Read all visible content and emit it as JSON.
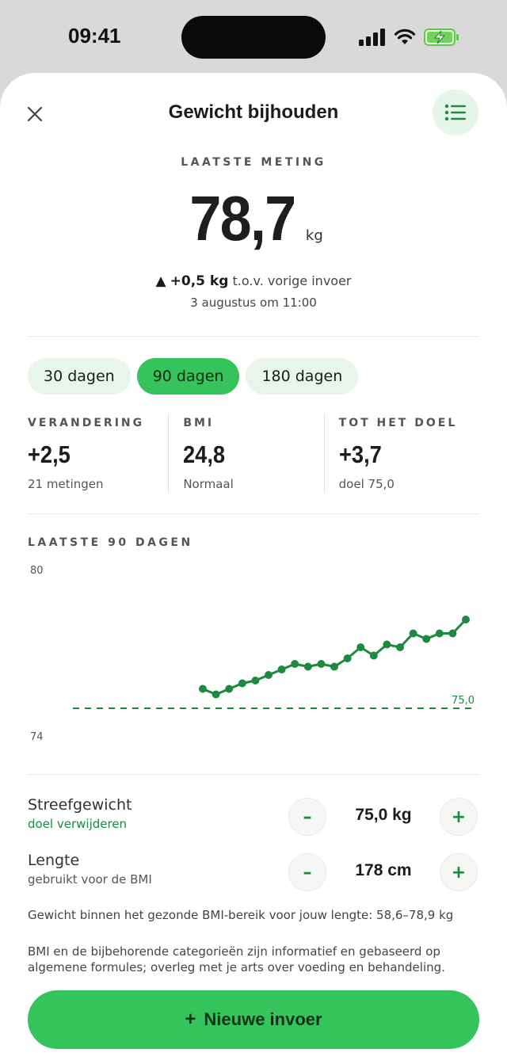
{
  "status": {
    "time": "09:41"
  },
  "header": {
    "title": "Gewicht bijhouden"
  },
  "latest": {
    "label": "LAATSTE METING",
    "value": "78,7",
    "unit": "kg",
    "delta_arrow": "▲",
    "delta": "+0,5 kg",
    "delta_suffix": "t.o.v. vorige invoer",
    "date": "3 augustus om 11:00"
  },
  "ranges": [
    {
      "label": "30 dagen",
      "active": false
    },
    {
      "label": "90 dagen",
      "active": true
    },
    {
      "label": "180 dagen",
      "active": false
    }
  ],
  "stats": [
    {
      "label": "VERANDERING",
      "value": "+2,5",
      "sub": "21 metingen"
    },
    {
      "label": "BMI",
      "value": "24,8",
      "sub": "Normaal"
    },
    {
      "label": "TOT HET DOEL",
      "value": "+3,7",
      "sub": "doel 75,0"
    }
  ],
  "chart_label": "LAATSTE 90 DAGEN",
  "chart_data": {
    "type": "line",
    "ylim": [
      74,
      80
    ],
    "y_ticks": [
      "80",
      "74"
    ],
    "series": [
      {
        "values": [
          75.7,
          75.5,
          75.7,
          75.9,
          76.0,
          76.2,
          76.4,
          76.6,
          76.5,
          76.6,
          76.5,
          76.8,
          77.2,
          76.9,
          77.3,
          77.2,
          77.7,
          77.5,
          77.7,
          77.7,
          78.2
        ]
      }
    ],
    "goal_value": 75.0,
    "goal_label": "75,0",
    "colors": {
      "line": "#1e8a41",
      "goal": "#1e8a41"
    }
  },
  "goal": {
    "title": "Streefgewicht",
    "link": "doel verwijderen",
    "value": "75,0 kg",
    "minus": "–",
    "plus": "+"
  },
  "height": {
    "title": "Lengte",
    "sub": "gebruikt voor de BMI",
    "value": "178 cm",
    "minus": "–",
    "plus": "+"
  },
  "info": {
    "healthy_range": "Gewicht binnen het gezonde BMI-bereik voor jouw lengte: 58,6–78,9 kg",
    "disclaimer": "BMI en de bijbehorende categorieën zijn informatief en gebaseerd op algemene formules; overleg met je arts over voeding en behandeling."
  },
  "cta": {
    "plus": "+",
    "label": "Nieuwe invoer"
  },
  "colors": {
    "accent": "#35c45b",
    "accent_dark": "#1e8a41",
    "chip_bg": "#e7f5ea"
  }
}
